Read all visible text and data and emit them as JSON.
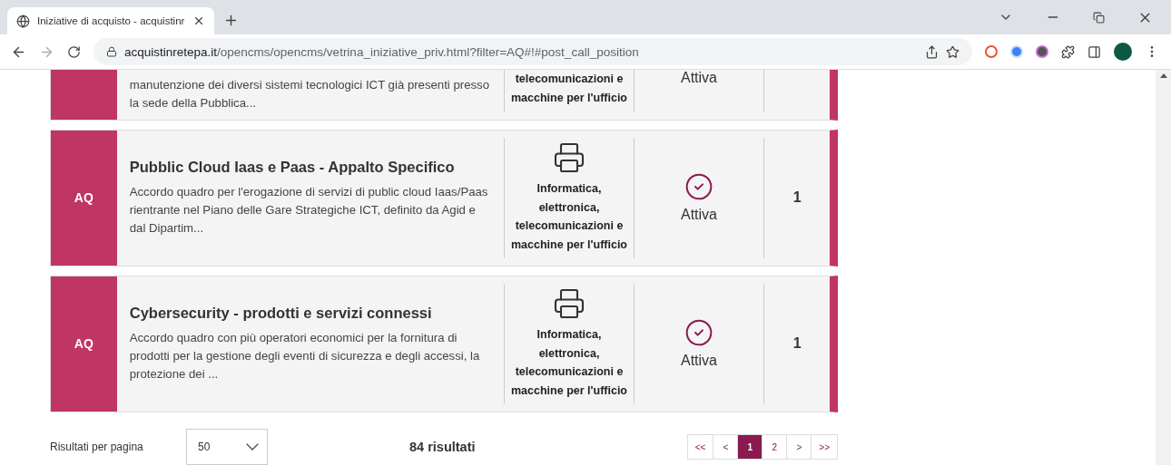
{
  "browser": {
    "tab_title": "Iniziative di acquisto - acquistinr",
    "url_domain": "acquistinretepa.it",
    "url_path": "/opencms/opencms/vetrina_iniziative_priv.html?filter=AQ#!#post_call_position"
  },
  "cards": [
    {
      "partial": true,
      "description": "manutenzione dei diversi sistemi tecnologici ICT già presenti presso la sede della Pubblica...",
      "category": "telecomunicazioni e macchine per l'ufficio",
      "status": "Attiva"
    },
    {
      "partial": false,
      "badge": "AQ",
      "title": "Pubblic Cloud Iaas e Paas - Appalto Specifico",
      "description": "Accordo quadro per l'erogazione di servizi di public cloud Iaas/Paas rientrante nel Piano delle Gare Strategiche ICT, definito da Agid e dal Dipartim...",
      "category": "Informatica, elettronica, telecomunicazioni e macchine per l'ufficio",
      "status": "Attiva",
      "count": "1"
    },
    {
      "partial": false,
      "badge": "AQ",
      "title": "Cybersecurity - prodotti e servizi connessi",
      "description": "Accordo quadro con più operatori economici per la fornitura di prodotti per la gestione degli eventi di sicurezza e degli accessi, la protezione dei ...",
      "category": "Informatica, elettronica, telecomunicazioni e macchine per l'ufficio",
      "status": "Attiva",
      "count": "1"
    }
  ],
  "footer": {
    "per_page_label": "Risultati per pagina",
    "per_page_value": "50",
    "results": "84 risultati",
    "pages": [
      {
        "label": "<<",
        "selected": false
      },
      {
        "label": "<",
        "selected": false
      },
      {
        "label": "1",
        "selected": true
      },
      {
        "label": "2",
        "selected": false
      },
      {
        "label": ">",
        "selected": false
      },
      {
        "label": ">>",
        "selected": false
      }
    ]
  }
}
